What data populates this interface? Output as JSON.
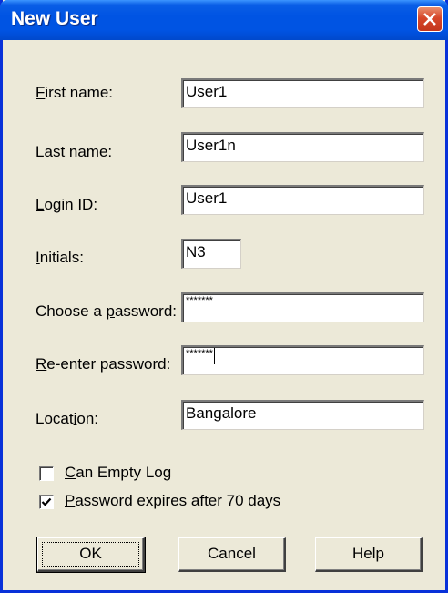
{
  "window": {
    "title": "New User"
  },
  "fields": {
    "first_name": {
      "label_accel": "F",
      "label_rest": "irst name:",
      "value": "User1"
    },
    "last_name": {
      "label_pre": "L",
      "label_accel": "a",
      "label_rest": "st name:",
      "value": "User1n"
    },
    "login_id": {
      "label_accel": "L",
      "label_rest": "ogin ID:",
      "value": "User1"
    },
    "initials": {
      "label_accel": "I",
      "label_rest": "nitials:",
      "value": "N3"
    },
    "password": {
      "label_pre": "Choose a ",
      "label_accel": "p",
      "label_rest": "assword:",
      "value": "*******"
    },
    "reenter_password": {
      "label_accel": "R",
      "label_rest": "e-enter password:",
      "value": "*******"
    },
    "location": {
      "label_pre": "Locat",
      "label_accel": "i",
      "label_rest": "on:",
      "value": "Bangalore"
    }
  },
  "options": {
    "can_empty_log": {
      "accel": "C",
      "rest": "an Empty Log",
      "checked": false
    },
    "password_expires": {
      "accel": "P",
      "rest": "assword expires after 70 days",
      "checked": true
    }
  },
  "buttons": {
    "ok": "OK",
    "cancel": "Cancel",
    "help": "Help"
  },
  "colors": {
    "titlebar": "#0054e3",
    "dialog_bg": "#ece9d8",
    "close_button": "#d6472a"
  }
}
